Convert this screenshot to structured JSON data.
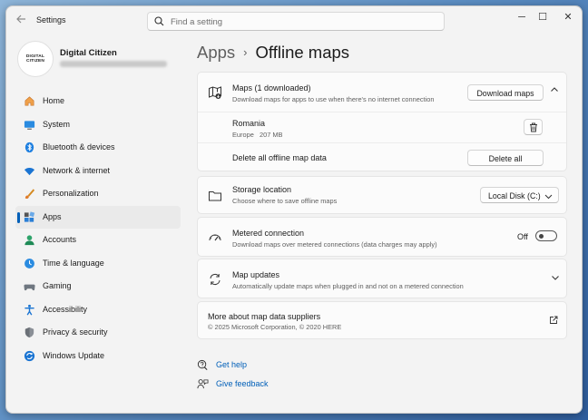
{
  "window": {
    "app_title": "Settings",
    "search_placeholder": "Find a setting",
    "controls": {
      "minimize": "─",
      "maximize": "☐",
      "close": "✕"
    }
  },
  "profile": {
    "name": "Digital Citizen",
    "avatar_text_1": "DIGITAL",
    "avatar_text_2": "CITIZEN"
  },
  "sidebar": {
    "items": [
      {
        "label": "Home",
        "icon": "home-icon"
      },
      {
        "label": "System",
        "icon": "system-icon"
      },
      {
        "label": "Bluetooth & devices",
        "icon": "bluetooth-icon"
      },
      {
        "label": "Network & internet",
        "icon": "network-icon"
      },
      {
        "label": "Personalization",
        "icon": "personalization-icon"
      },
      {
        "label": "Apps",
        "icon": "apps-icon",
        "active": true
      },
      {
        "label": "Accounts",
        "icon": "accounts-icon"
      },
      {
        "label": "Time & language",
        "icon": "time-language-icon"
      },
      {
        "label": "Gaming",
        "icon": "gaming-icon"
      },
      {
        "label": "Accessibility",
        "icon": "accessibility-icon"
      },
      {
        "label": "Privacy & security",
        "icon": "privacy-icon"
      },
      {
        "label": "Windows Update",
        "icon": "windows-update-icon"
      }
    ]
  },
  "breadcrumb": {
    "parent": "Apps",
    "separator": "›",
    "current": "Offline maps"
  },
  "maps": {
    "title": "Maps (1 downloaded)",
    "subtitle": "Download maps for apps to use when there's no internet connection",
    "download_button": "Download maps",
    "downloaded": {
      "name": "Romania",
      "detail": "Europe   207 MB"
    },
    "delete_all_label": "Delete all offline map data",
    "delete_all_button": "Delete all"
  },
  "storage": {
    "title": "Storage location",
    "subtitle": "Choose where to save offline maps",
    "selected": "Local Disk (C:)"
  },
  "metered": {
    "title": "Metered connection",
    "subtitle": "Download maps over metered connections (data charges may apply)",
    "state": "Off"
  },
  "updates": {
    "title": "Map updates",
    "subtitle": "Automatically update maps when plugged in and not on a metered connection"
  },
  "suppliers": {
    "title": "More about map data suppliers",
    "subtitle": "© 2025 Microsoft Corporation, © 2020 HERE"
  },
  "help": {
    "get_help": "Get help",
    "give_feedback": "Give feedback"
  },
  "colors": {
    "accent": "#005fb8",
    "window_bg": "#f3f3f3",
    "card_bg": "#fbfbfb"
  }
}
